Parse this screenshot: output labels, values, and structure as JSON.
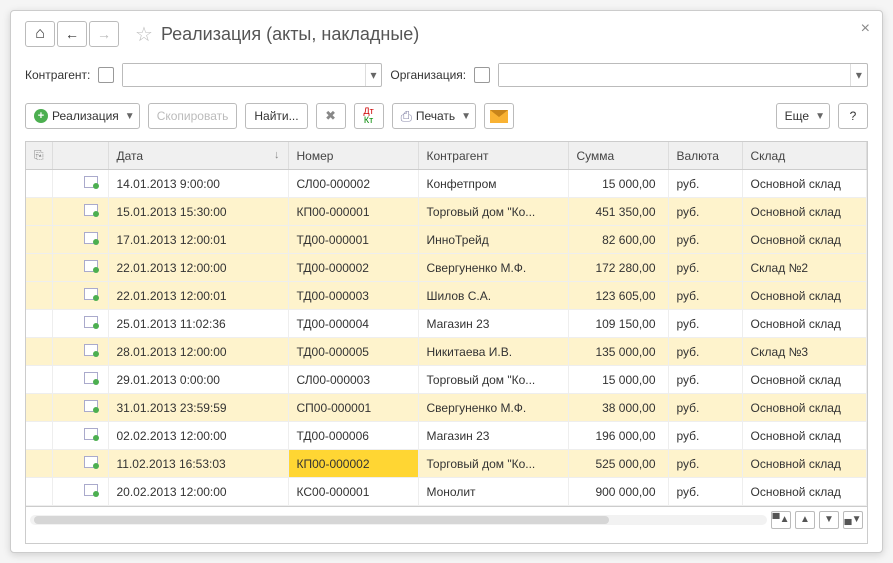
{
  "title": "Реализация (акты, накладные)",
  "filter": {
    "contractor_label": "Контрагент:",
    "org_label": "Организация:"
  },
  "toolbar": {
    "add_label": "Реализация",
    "copy_label": "Скопировать",
    "find_label": "Найти...",
    "print_label": "Печать",
    "more_label": "Еще",
    "help_label": "?"
  },
  "columns": {
    "attach": "",
    "status": "",
    "date": "Дата",
    "number": "Номер",
    "contractor": "Контрагент",
    "sum": "Сумма",
    "currency": "Валюта",
    "warehouse": "Склад"
  },
  "rows": [
    {
      "date": "14.01.2013 9:00:00",
      "number": "СЛ00-000002",
      "contractor": "Конфетпром",
      "sum": "15 000,00",
      "currency": "руб.",
      "warehouse": "Основной склад",
      "alt": false
    },
    {
      "date": "15.01.2013 15:30:00",
      "number": "КП00-000001",
      "contractor": "Торговый дом \"Ко...",
      "sum": "451 350,00",
      "currency": "руб.",
      "warehouse": "Основной склад",
      "alt": true
    },
    {
      "date": "17.01.2013 12:00:01",
      "number": "ТД00-000001",
      "contractor": "ИнноТрейд",
      "sum": "82 600,00",
      "currency": "руб.",
      "warehouse": "Основной склад",
      "alt": true
    },
    {
      "date": "22.01.2013 12:00:00",
      "number": "ТД00-000002",
      "contractor": "Свергуненко М.Ф.",
      "sum": "172 280,00",
      "currency": "руб.",
      "warehouse": "Склад №2",
      "alt": true
    },
    {
      "date": "22.01.2013 12:00:01",
      "number": "ТД00-000003",
      "contractor": "Шилов С.А.",
      "sum": "123 605,00",
      "currency": "руб.",
      "warehouse": "Основной склад",
      "alt": true
    },
    {
      "date": "25.01.2013 11:02:36",
      "number": "ТД00-000004",
      "contractor": "Магазин 23",
      "sum": "109 150,00",
      "currency": "руб.",
      "warehouse": "Основной склад",
      "alt": false
    },
    {
      "date": "28.01.2013 12:00:00",
      "number": "ТД00-000005",
      "contractor": "Никитаева И.В.",
      "sum": "135 000,00",
      "currency": "руб.",
      "warehouse": "Склад №3",
      "alt": true
    },
    {
      "date": "29.01.2013 0:00:00",
      "number": "СЛ00-000003",
      "contractor": "Торговый дом \"Ко...",
      "sum": "15 000,00",
      "currency": "руб.",
      "warehouse": "Основной склад",
      "alt": false
    },
    {
      "date": "31.01.2013 23:59:59",
      "number": "СП00-000001",
      "contractor": "Свергуненко М.Ф.",
      "sum": "38 000,00",
      "currency": "руб.",
      "warehouse": "Основной склад",
      "alt": true
    },
    {
      "date": "02.02.2013 12:00:00",
      "number": "ТД00-000006",
      "contractor": "Магазин 23",
      "sum": "196 000,00",
      "currency": "руб.",
      "warehouse": "Основной склад",
      "alt": false
    },
    {
      "date": "11.02.2013 16:53:03",
      "number": "КП00-000002",
      "contractor": "Торговый дом \"Ко...",
      "sum": "525 000,00",
      "currency": "руб.",
      "warehouse": "Основной склад",
      "alt": true,
      "highlight_number": true
    },
    {
      "date": "20.02.2013 12:00:00",
      "number": "КС00-000001",
      "contractor": "Монолит",
      "sum": "900 000,00",
      "currency": "руб.",
      "warehouse": "Основной склад",
      "alt": false
    }
  ]
}
